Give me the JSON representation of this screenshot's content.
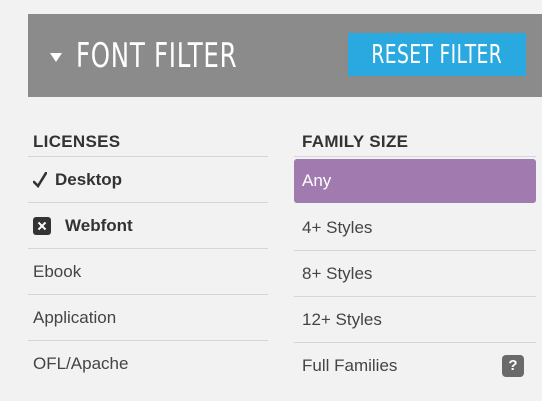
{
  "header": {
    "title": "FONT FILTER",
    "reset_label": "RESET FILTER"
  },
  "licenses": {
    "heading": "LICENSES",
    "items": [
      {
        "label": "Desktop",
        "icon": "check-icon",
        "state": "checked"
      },
      {
        "label": "Webfont",
        "icon": "x-icon",
        "state": "excluded"
      },
      {
        "label": "Ebook"
      },
      {
        "label": "Application"
      },
      {
        "label": "OFL/Apache"
      }
    ]
  },
  "family_size": {
    "heading": "FAMILY SIZE",
    "selected": "Any",
    "items": [
      {
        "label": "Any"
      },
      {
        "label": "4+ Styles"
      },
      {
        "label": "8+ Styles"
      },
      {
        "label": "12+ Styles"
      },
      {
        "label": "Full Families",
        "help": "?"
      }
    ]
  },
  "colors": {
    "header_bg": "#8b8b8b",
    "reset_bg": "#29a9e0",
    "selected_bg": "#a17ab0",
    "panel_bg": "#f2f2f2"
  }
}
